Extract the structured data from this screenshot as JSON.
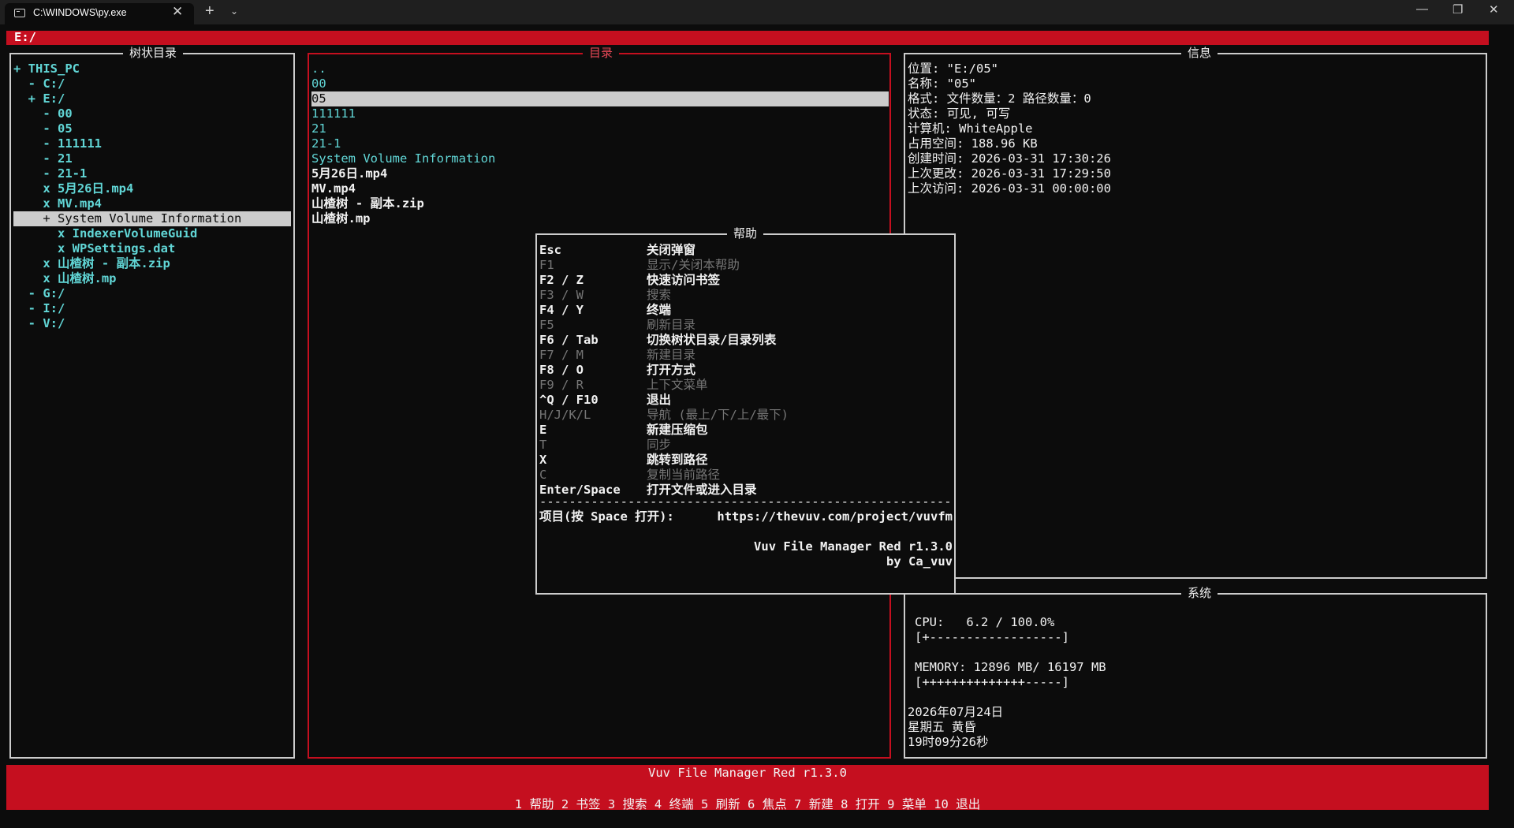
{
  "window": {
    "tab_title": "C:\\WINDOWS\\py.exe",
    "close_glyph": "✕",
    "new_tab_glyph": "+",
    "dropdown_glyph": "⌄",
    "minimize_glyph": "—",
    "maximize_glyph": "❐",
    "window_close_glyph": "✕"
  },
  "path_bar": "E:/",
  "colors": {
    "accent": "#c50f1f",
    "tree_text": "#61d6d6",
    "selection": "#cccccc",
    "border": "#cccccc"
  },
  "tree": {
    "title": "树状目录",
    "items": [
      {
        "text": "+ THIS_PC"
      },
      {
        "text": "  - C:/"
      },
      {
        "text": "  + E:/"
      },
      {
        "text": "    - 00"
      },
      {
        "text": "    - 05"
      },
      {
        "text": "    - 111111"
      },
      {
        "text": "    - 21"
      },
      {
        "text": "    - 21-1"
      },
      {
        "text": "    x 5月26日.mp4"
      },
      {
        "text": "    x MV.mp4"
      },
      {
        "text": "    + System Volume Information"
      },
      {
        "text": "      x IndexerVolumeGuid"
      },
      {
        "text": "      x WPSettings.dat"
      },
      {
        "text": "    x 山楂树 - 副本.zip"
      },
      {
        "text": "    x 山楂树.mp"
      },
      {
        "text": "  - G:/"
      },
      {
        "text": "  - I:/"
      },
      {
        "text": "  - V:/"
      }
    ]
  },
  "dir": {
    "title": "目录",
    "items": [
      {
        "text": ".."
      },
      {
        "text": "00"
      },
      {
        "text": "05"
      },
      {
        "text": "111111"
      },
      {
        "text": "21"
      },
      {
        "text": "21-1"
      },
      {
        "text": "System Volume Information"
      },
      {
        "text": "5月26日.mp4"
      },
      {
        "text": "MV.mp4"
      },
      {
        "text": "山楂树 - 副本.zip"
      },
      {
        "text": "山楂树.mp"
      }
    ]
  },
  "info": {
    "title": "信息",
    "lines": [
      "位置: \"E:/05\"",
      "名称: \"05\"",
      "格式: 文件数量：2 路径数量：0",
      "状态: 可见, 可写",
      "计算机: WhiteApple",
      "占用空间: 188.96 KB",
      "创建时间: 2026-03-31 17:30:26",
      "上次更改: 2026-03-31 17:29:50",
      "上次访问: 2026-03-31 00:00:00"
    ]
  },
  "system": {
    "title": "系统",
    "cpu_label": "CPU:   6.2 / 100.0%",
    "cpu_bar": "[+------------------]",
    "cpu_percent": 6.2,
    "memory_label": "MEMORY: 12896 MB/ 16197 MB",
    "memory_bar": "[++++++++++++++-----]",
    "memory_used_mb": 12896,
    "memory_total_mb": 16197,
    "date": "2026年07月24日",
    "weekday": "星期五 黄昏",
    "time": "19时09分26秒"
  },
  "help": {
    "title": "帮助",
    "rows": [
      {
        "key": "Esc",
        "desc": "关闭弹窗"
      },
      {
        "key": "F1",
        "desc": "显示/关闭本帮助"
      },
      {
        "key": "F2 / Z",
        "desc": "快速访问书签"
      },
      {
        "key": "F3 / W",
        "desc": "搜索"
      },
      {
        "key": "F4 / Y",
        "desc": "终端"
      },
      {
        "key": "F5",
        "desc": "刷新目录"
      },
      {
        "key": "F6 / Tab",
        "desc": "切换树状目录/目录列表"
      },
      {
        "key": "F7 / M",
        "desc": "新建目录"
      },
      {
        "key": "F8 / O",
        "desc": "打开方式"
      },
      {
        "key": "F9 / R",
        "desc": "上下文菜单"
      },
      {
        "key": "^Q / F10",
        "desc": "退出"
      },
      {
        "key": "H/J/K/L",
        "desc": "导航 (最上/下/上/最下)"
      },
      {
        "key": "E",
        "desc": "新建压缩包"
      },
      {
        "key": "T",
        "desc": "同步"
      },
      {
        "key": "X",
        "desc": "跳转到路径"
      },
      {
        "key": "C",
        "desc": "复制当前路径"
      },
      {
        "key": "Enter/Space",
        "desc": "打开文件或进入目录"
      }
    ],
    "separator": "--------------------------------------------------------",
    "project_label": "项目(按 Space 打开):",
    "project_url": "https://thevuv.com/project/vuvfm",
    "app_version": "Vuv File Manager Red r1.3.0",
    "author": "by Ca_vuv"
  },
  "footer": {
    "title": "Vuv File Manager Red r1.3.0",
    "keys": [
      {
        "num": "1",
        "label": "帮助"
      },
      {
        "num": "2",
        "label": "书签"
      },
      {
        "num": "3",
        "label": "搜索"
      },
      {
        "num": "4",
        "label": "终端"
      },
      {
        "num": "5",
        "label": "刷新"
      },
      {
        "num": "6",
        "label": "焦点"
      },
      {
        "num": "7",
        "label": "新建"
      },
      {
        "num": "8",
        "label": "打开"
      },
      {
        "num": "9",
        "label": "菜单"
      },
      {
        "num": "10",
        "label": "退出"
      }
    ]
  }
}
